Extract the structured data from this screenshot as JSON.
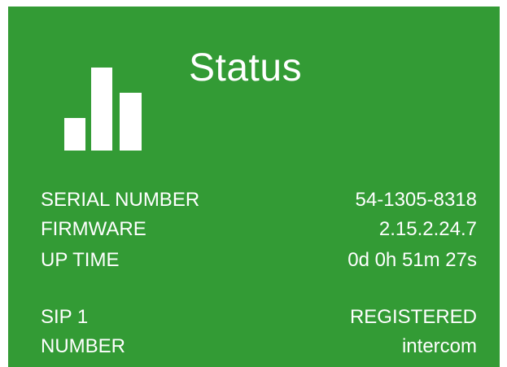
{
  "tile": {
    "title": "Status",
    "icon": "bar-chart-icon",
    "color": "#339b35"
  },
  "info": [
    {
      "label": "SERIAL NUMBER",
      "value": "54-1305-8318"
    },
    {
      "label": "FIRMWARE",
      "value": "2.15.2.24.7"
    },
    {
      "label": "UP TIME",
      "value": "0d 0h 51m 27s"
    },
    {
      "label": "SIP 1",
      "value": "REGISTERED"
    },
    {
      "label": "NUMBER",
      "value": "intercom"
    }
  ]
}
